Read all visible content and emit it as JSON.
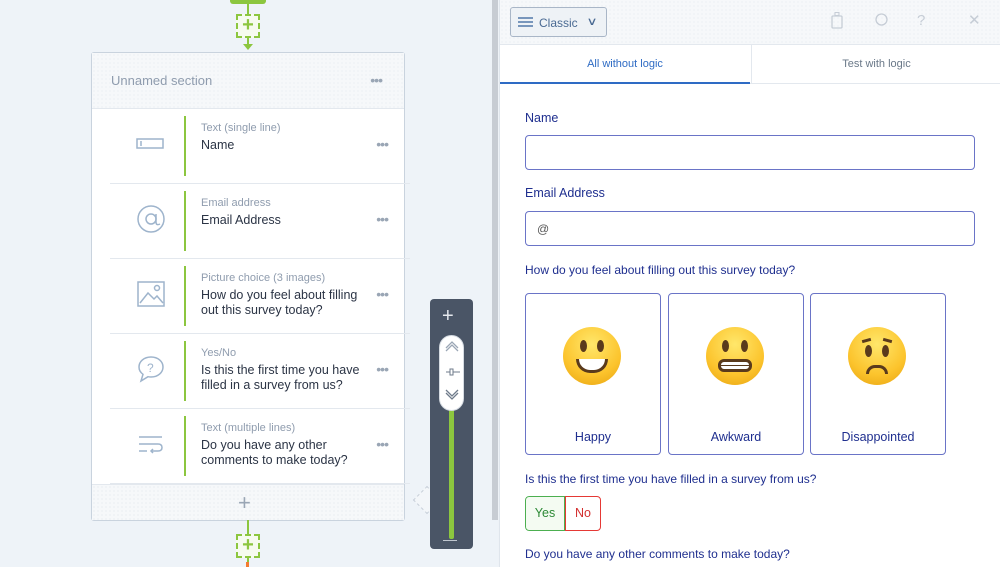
{
  "builder": {
    "section_title": "Unnamed section",
    "questions": [
      {
        "type": "Text (single line)",
        "label": "Name",
        "icon": "text-single-line-icon"
      },
      {
        "type": "Email address",
        "label": "Email Address",
        "icon": "at-sign-icon"
      },
      {
        "type": "Picture choice (3 images)",
        "label": "How do you feel about filling out this survey today?",
        "icon": "image-icon"
      },
      {
        "type": "Yes/No",
        "label": "Is this the first time you have filled in a survey from us?",
        "icon": "speech-question-icon"
      },
      {
        "type": "Text (multiple lines)",
        "label": "Do you have any other comments to make today?",
        "icon": "text-multi-line-icon"
      }
    ],
    "accent_color": "#8cc63f"
  },
  "preview": {
    "view_mode": "Classic",
    "tabs": [
      "All without logic",
      "Test with logic"
    ],
    "active_tab": "All without logic",
    "fields": {
      "name_label": "Name",
      "email_label": "Email Address",
      "email_placeholder": "@",
      "picture_question": "How do you feel about filling out this survey today?",
      "picture_choices": [
        "Happy",
        "Awkward",
        "Disappointed"
      ],
      "yes_no_question": "Is this the first time you have filled in a survey from us?",
      "yes_label": "Yes",
      "no_label": "No",
      "comments_question": "Do you have any other comments to make today?"
    },
    "label_color": "#1f2f8f",
    "input_border_color": "#6a74c7"
  }
}
